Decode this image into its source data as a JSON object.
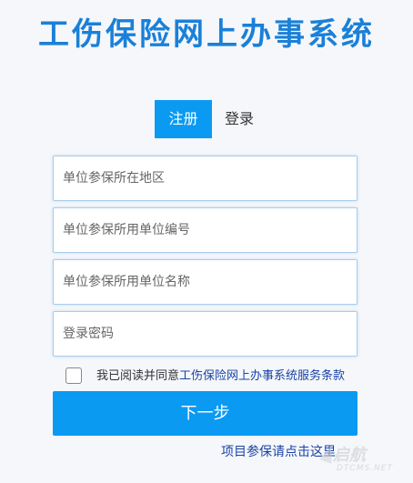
{
  "header": {
    "title": "工伤保险网上办事系统"
  },
  "tabs": [
    {
      "label": "注册",
      "active": true
    },
    {
      "label": "登录",
      "active": false
    }
  ],
  "form": {
    "fields": [
      {
        "placeholder": "单位参保所在地区",
        "value": ""
      },
      {
        "placeholder": "单位参保所用单位编号",
        "value": ""
      },
      {
        "placeholder": "单位参保所用单位名称",
        "value": ""
      },
      {
        "placeholder": "登录密码",
        "value": ""
      }
    ],
    "agreement": {
      "checked": false,
      "prefix": "我已阅读并同意",
      "link": "工伤保险网上办事系统服务条款"
    },
    "next_label": "下一步"
  },
  "footer": {
    "register_link": "项目参保请点击这里"
  },
  "watermark": {
    "line1": "启航",
    "line2": "DTCMS.NET"
  },
  "colors": {
    "accent": "#0a9af2",
    "title": "#1a80d8",
    "link": "#1b44a5",
    "background": "#f5f7fa"
  }
}
